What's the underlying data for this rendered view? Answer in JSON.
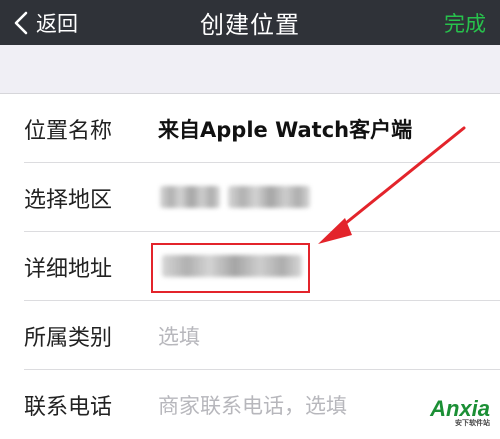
{
  "navbar": {
    "back_label": "返回",
    "title": "创建位置",
    "done_label": "完成",
    "done_color": "#27c24c"
  },
  "form": {
    "rows": [
      {
        "label": "位置名称",
        "value": "来自Apple Watch客户端"
      },
      {
        "label": "选择地区"
      },
      {
        "label": "详细地址"
      },
      {
        "label": "所属类别",
        "placeholder": "选填"
      },
      {
        "label": "联系电话",
        "placeholder": "商家联系电话，选填"
      }
    ]
  },
  "annotation": {
    "color": "#e3242b"
  },
  "watermark": {
    "text": "Anxia",
    "sub": "安下软件站"
  }
}
